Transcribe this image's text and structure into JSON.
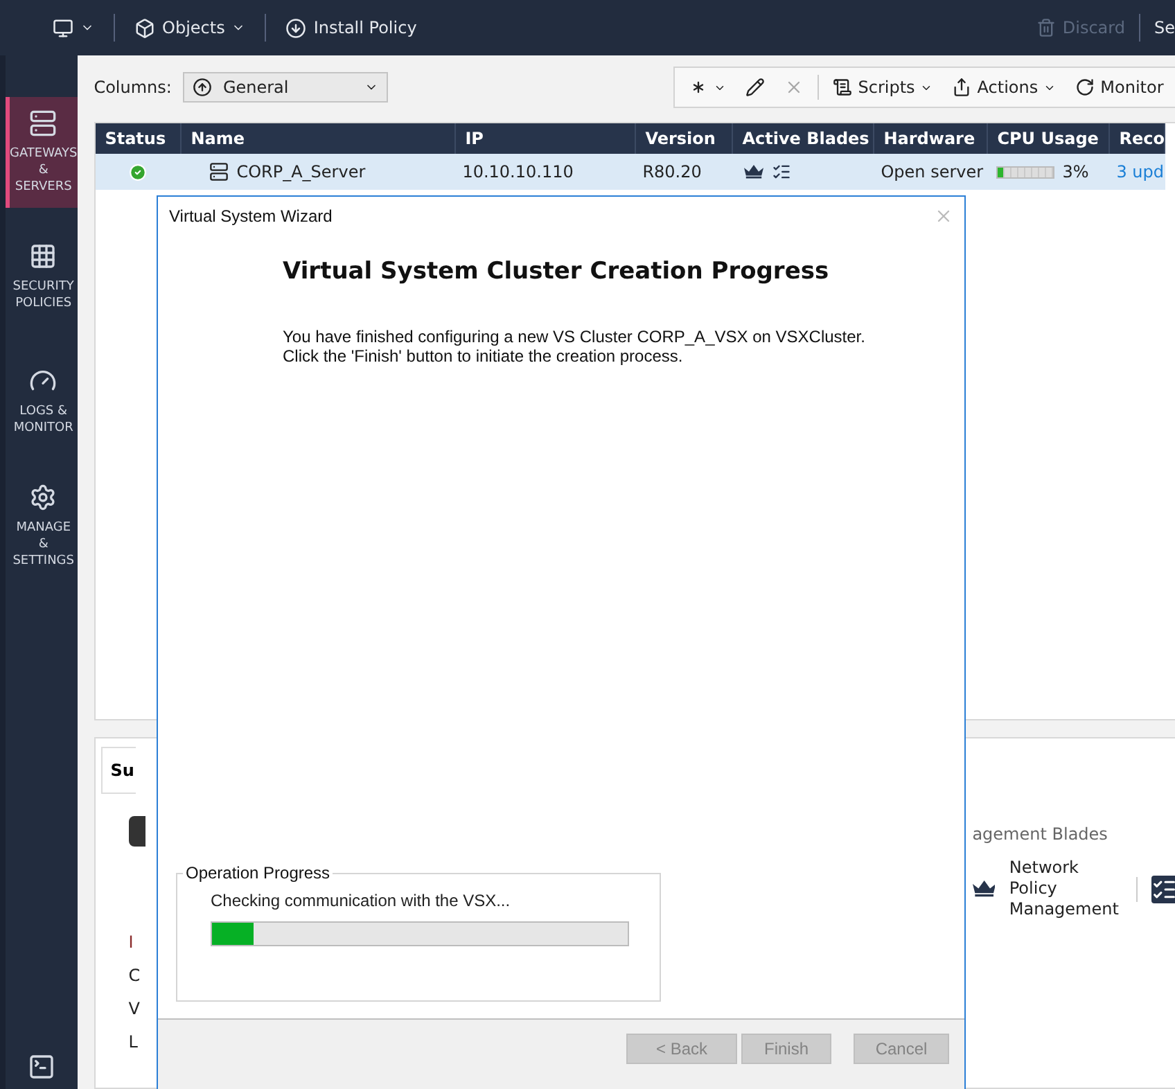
{
  "top_bar": {
    "items": [
      {
        "kind": "icon_menu"
      },
      {
        "kind": "menu",
        "label": "Objects"
      },
      {
        "kind": "button",
        "label": "Install Policy"
      }
    ],
    "right_items": [
      {
        "label": "Discard",
        "disabled": true
      },
      {
        "label": "Se",
        "disabled": false
      }
    ]
  },
  "sidebar": {
    "items": [
      {
        "label": "GATEWAYS\n& SERVERS",
        "selected": true
      },
      {
        "label": "SECURITY\nPOLICIES",
        "selected": false
      },
      {
        "label": "LOGS &\nMONITOR",
        "selected": false
      },
      {
        "label": "MANAGE &\nSETTINGS",
        "selected": false
      }
    ]
  },
  "columns_bar": {
    "label": "Columns:",
    "value": "General"
  },
  "tools": [
    {
      "kind": "icon_menu"
    },
    {
      "kind": "icon",
      "disabled": false
    },
    {
      "kind": "icon",
      "disabled": true
    },
    {
      "kind": "menu",
      "label": "Scripts"
    },
    {
      "kind": "menu",
      "label": "Actions"
    },
    {
      "kind": "button",
      "label": "Monitor"
    }
  ],
  "table": {
    "columns": [
      "Status",
      "Name",
      "IP",
      "Version",
      "Active Blades",
      "Hardware",
      "CPU Usage",
      "Reco"
    ],
    "rows": [
      {
        "ok": true,
        "name": "CORP_A_Server",
        "ip": "10.10.10.110",
        "version": "R80.20",
        "hardware": "Open server",
        "cpu": {
          "level": 0.1,
          "reading": "3%"
        },
        "column_8": "3 upd",
        "selected": true
      }
    ]
  },
  "details": {
    "tab": "Su",
    "fragments": [
      "I",
      "C",
      "V",
      "L"
    ],
    "blades_heading": "agement Blades",
    "blades": [
      {
        "kind": "labeled",
        "label": "Network Policy\nManagement"
      },
      {
        "kind": "icon"
      }
    ]
  },
  "dialog": {
    "title": "Virtual System Wizard",
    "heading": "Virtual System Cluster Creation Progress",
    "description": [
      "You have finished configuring a new VS Cluster CORP_A_VSX on VSXCluster.",
      "Click the 'Finish' button to initiate the creation process."
    ],
    "progress": {
      "legend": "Operation Progress",
      "status": "Checking communication with the VSX...",
      "level": 0.1
    },
    "buttons": [
      {
        "label": "< Back",
        "disabled": true
      },
      {
        "label": "Finish",
        "disabled": true
      },
      {
        "label": "Cancel",
        "disabled": true
      }
    ]
  }
}
